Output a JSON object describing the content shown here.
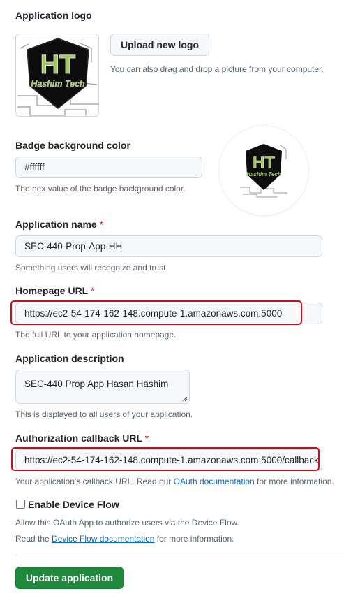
{
  "logo_section": {
    "label": "Application logo",
    "upload_button": "Upload new logo",
    "hint": "You can also drag and drop a picture from your computer.",
    "logo_text_main": "HT",
    "logo_text_sub": "Hashim Tech"
  },
  "badge": {
    "label": "Badge background color",
    "value": "#ffffff",
    "hint": "The hex value of the badge background color."
  },
  "app_name": {
    "label": "Application name",
    "required_mark": "*",
    "value": "SEC-440-Prop-App-HH",
    "hint": "Something users will recognize and trust."
  },
  "homepage": {
    "label": "Homepage URL",
    "required_mark": "*",
    "value": "https://ec2-54-174-162-148.compute-1.amazonaws.com:5000",
    "hint": "The full URL to your application homepage."
  },
  "description": {
    "label": "Application description",
    "value": "SEC-440 Prop App Hasan Hashim",
    "hint": "This is displayed to all users of your application."
  },
  "callback": {
    "label": "Authorization callback URL",
    "required_mark": "*",
    "value": "https://ec2-54-174-162-148.compute-1.amazonaws.com:5000/callback",
    "hint_prefix": "Your application's callback URL. Read our ",
    "hint_link": "OAuth documentation",
    "hint_suffix": " for more information."
  },
  "device_flow": {
    "label": "Enable Device Flow",
    "checked": false,
    "hint_line1": "Allow this OAuth App to authorize users via the Device Flow.",
    "hint_line2_prefix": "Read the ",
    "hint_line2_link": "Device Flow documentation",
    "hint_line2_suffix": " for more information."
  },
  "submit": {
    "label": "Update application"
  },
  "colors": {
    "highlight": "#c80f1f",
    "primary_button": "#1f883d",
    "link": "#0969da",
    "logo_text": "#a3c464"
  }
}
